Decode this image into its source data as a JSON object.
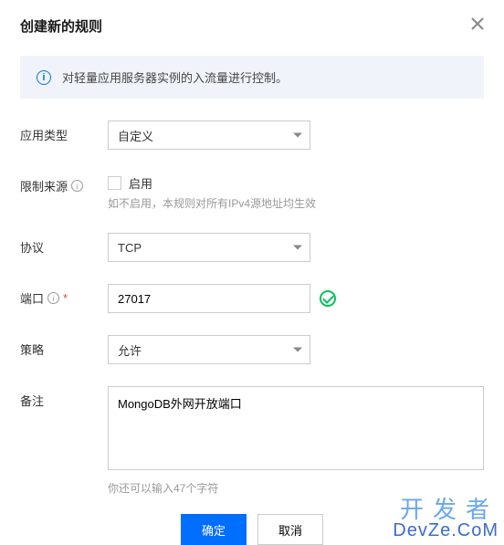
{
  "dialog": {
    "title": "创建新的规则",
    "info_text": "对轻量应用服务器实例的入流量进行控制。"
  },
  "form": {
    "app_type": {
      "label": "应用类型",
      "value": "自定义"
    },
    "restrict_source": {
      "label": "限制来源",
      "enable_label": "启用",
      "hint": "如不启用，本规则对所有IPv4源地址均生效"
    },
    "protocol": {
      "label": "协议",
      "value": "TCP"
    },
    "port": {
      "label": "端口",
      "value": "27017"
    },
    "policy": {
      "label": "策略",
      "value": "允许"
    },
    "remark": {
      "label": "备注",
      "value": "MongoDB外网开放端口",
      "hint": "你还可以输入47个字符"
    }
  },
  "buttons": {
    "ok": "确定",
    "cancel": "取消"
  },
  "watermark": {
    "line1": "开发者",
    "line2": "DevZe.CoM"
  }
}
